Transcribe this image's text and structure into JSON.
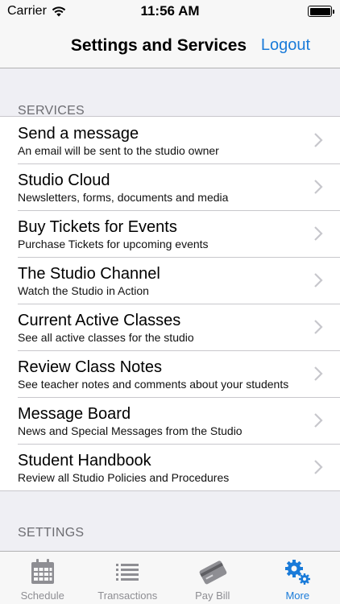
{
  "status": {
    "carrier": "Carrier",
    "time": "11:56 AM"
  },
  "nav": {
    "title": "Settings and Services",
    "logout_label": "Logout"
  },
  "sections": {
    "services_header": "SERVICES",
    "settings_header": "SETTINGS"
  },
  "services": [
    {
      "title": "Send a message",
      "subtitle": "An email will be sent to the studio owner"
    },
    {
      "title": "Studio Cloud",
      "subtitle": "Newsletters, forms, documents and media"
    },
    {
      "title": "Buy Tickets for Events",
      "subtitle": "Purchase Tickets for upcoming events"
    },
    {
      "title": "The Studio Channel",
      "subtitle": "Watch the Studio in Action"
    },
    {
      "title": "Current Active Classes",
      "subtitle": "See all active classes for the studio"
    },
    {
      "title": "Review Class Notes",
      "subtitle": "See teacher notes and comments about your students"
    },
    {
      "title": "Message Board",
      "subtitle": "News and Special Messages from the Studio"
    },
    {
      "title": "Student Handbook",
      "subtitle": "Review all Studio Policies and Procedures"
    }
  ],
  "tabs": [
    {
      "label": "Schedule",
      "icon": "calendar-icon",
      "active": false
    },
    {
      "label": "Transactions",
      "icon": "list-icon",
      "active": false
    },
    {
      "label": "Pay Bill",
      "icon": "credit-card-icon",
      "active": false
    },
    {
      "label": "More",
      "icon": "gears-icon",
      "active": true
    }
  ],
  "colors": {
    "accent": "#1a7bd9",
    "background": "#efeff4",
    "inactive": "#8e8e93"
  }
}
